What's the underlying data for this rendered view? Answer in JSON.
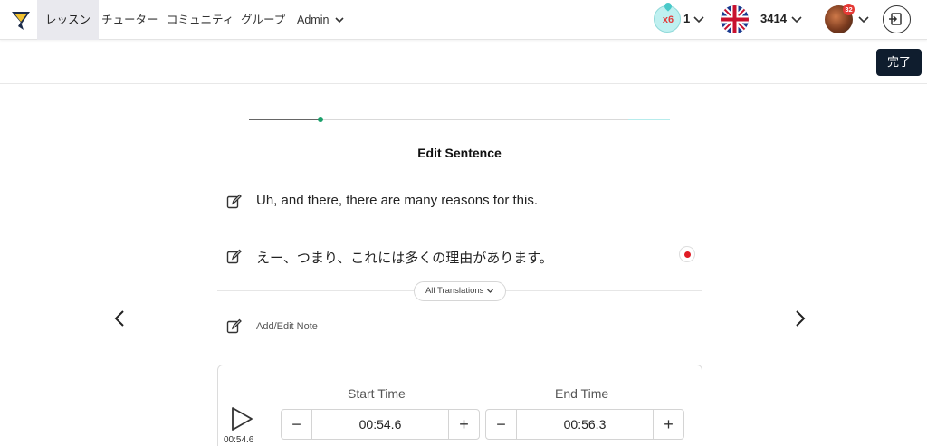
{
  "nav": {
    "items": [
      {
        "label": "レッスン",
        "active": true
      },
      {
        "label": "チューター",
        "active": false
      },
      {
        "label": "コミュニティ",
        "active": false
      },
      {
        "label": "グループ",
        "active": false
      },
      {
        "label": "Admin",
        "active": false
      }
    ],
    "streak": {
      "multiplier": "x6",
      "count": "1"
    },
    "language": {
      "flag": "uk-flag-icon",
      "points": "3414"
    },
    "avatar_badge": "32",
    "icons": {
      "logo": "logo-icon",
      "logout": "logout-icon"
    }
  },
  "header": {
    "done_label": "完了"
  },
  "editor": {
    "progress": {
      "fraction": 0.17,
      "tail_start": 0.9
    },
    "title": "Edit Sentence",
    "sentence": "Uh, and there, there are many reasons for this.",
    "translation": "えー、つまり、これには多くの理由があります。",
    "all_translations_label": "All Translations",
    "note_label": "Add/Edit Note"
  },
  "timing": {
    "play_time": "00:54.6",
    "start_label": "Start Time",
    "start_value": "00:54.6",
    "end_label": "End Time",
    "end_value": "00:56.3",
    "minus": "−",
    "plus": "+"
  },
  "colors": {
    "accent_dark": "#0f1d2e",
    "record_red": "#e01b24",
    "progress_green": "#1aa06a",
    "streak_red": "#e23b3b"
  }
}
